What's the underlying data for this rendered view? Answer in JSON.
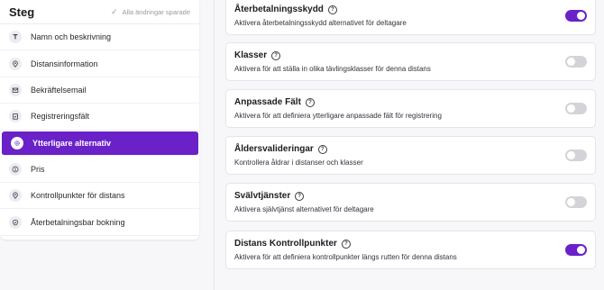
{
  "sidebar": {
    "title": "Steg",
    "saved_status": "Alla ändringar sparade",
    "items": [
      {
        "label": "Namn och beskrivning",
        "icon": "text-icon",
        "active": false
      },
      {
        "label": "Distansinformation",
        "icon": "location-pin-icon",
        "active": false
      },
      {
        "label": "Bekräftelsemail",
        "icon": "envelope-icon",
        "active": false
      },
      {
        "label": "Registreringsfält",
        "icon": "clipboard-icon",
        "active": false
      },
      {
        "label": "Ytterligare alternativ",
        "icon": "gear-icon",
        "active": true
      },
      {
        "label": "Pris",
        "icon": "dollar-icon",
        "active": false
      },
      {
        "label": "Kontrollpunkter för distans",
        "icon": "location-pin-icon",
        "active": false
      },
      {
        "label": "Återbetalningsbar bokning",
        "icon": "shield-icon",
        "active": false
      }
    ]
  },
  "settings": [
    {
      "title": "Återbetalningsskydd",
      "description": "Aktivera återbetalningsskydd alternativet för deltagare",
      "enabled": true
    },
    {
      "title": "Klasser",
      "description": "Aktivera för att ställa in olika tävlingsklasser för denna distans",
      "enabled": false
    },
    {
      "title": "Anpassade Fält",
      "description": "Aktivera för att definiera ytterligare anpassade fält för registrering",
      "enabled": false
    },
    {
      "title": "Åldersvalideringar",
      "description": "Kontrollera åldrar i distanser och klasser",
      "enabled": false
    },
    {
      "title": "Svälvtjänster",
      "description": "Aktivera självtjänst alternativet för deltagare",
      "enabled": false
    },
    {
      "title": "Distans Kontrollpunkter",
      "description": "Aktivera för att definiera kontrollpunkter längs rutten för denna distans",
      "enabled": true
    }
  ],
  "colors": {
    "accent": "#6a21c8",
    "toggle_off": "#d4d4d8"
  }
}
